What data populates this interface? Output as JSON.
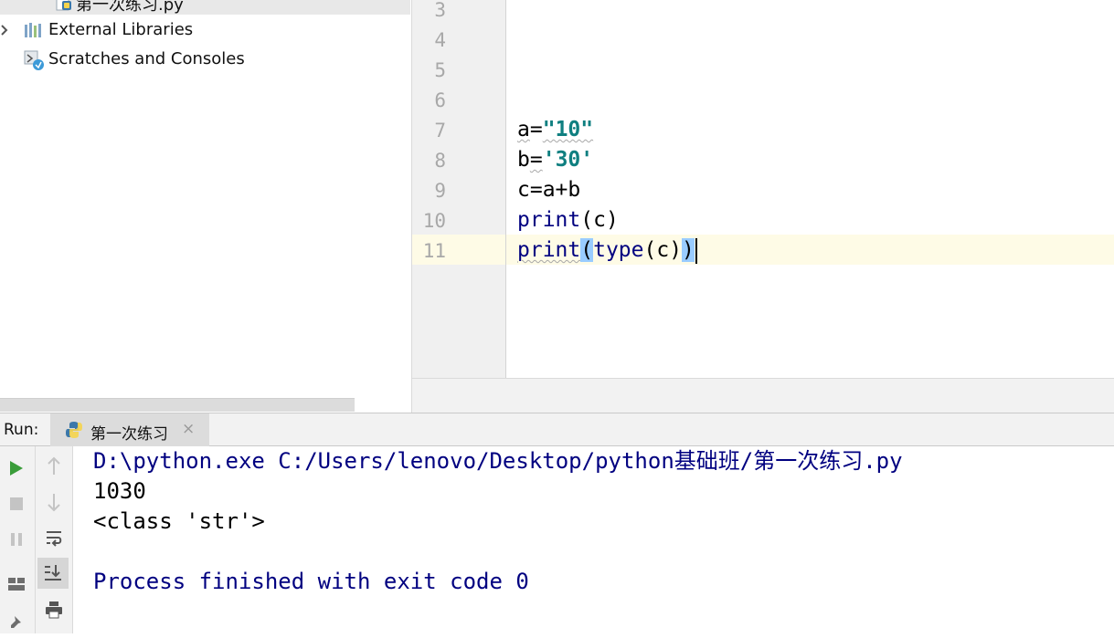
{
  "project_tree": {
    "items": [
      {
        "label": "第一次练习.py",
        "icon": "python-file-icon"
      },
      {
        "label": "External Libraries",
        "icon": "libraries-icon"
      },
      {
        "label": "Scratches and Consoles",
        "icon": "scratches-icon"
      }
    ]
  },
  "editor": {
    "line_numbers": [
      "3",
      "4",
      "5",
      "6",
      "7",
      "8",
      "9",
      "10",
      "11"
    ],
    "lines": {
      "l7": {
        "var": "a",
        "eq": "=",
        "value": "\"10\""
      },
      "l8": {
        "var": "b",
        "eq": "=",
        "value": "'30'"
      },
      "l9": {
        "text": "c=a+b"
      },
      "l10": {
        "fn": "print",
        "args": "(c)"
      },
      "l11": {
        "fn": "print",
        "open": "(",
        "inner_fn": "type",
        "inner_args": "(c)",
        "close": ")"
      }
    },
    "current_line": "11"
  },
  "run_window": {
    "label": "Run:",
    "tab_title": "第一次练习",
    "tab_close": "×",
    "console": {
      "command": "D:\\python.exe C:/Users/lenovo/Desktop/python基础班/第一次练习.py",
      "output_1": "1030",
      "output_2": "<class 'str'>",
      "exit_message": "Process finished with exit code 0"
    }
  },
  "colors": {
    "string_literal": "#0f7f80",
    "console_system": "#000080",
    "brace_highlight": "#99ccff",
    "caret_line": "#fefbe6",
    "run_green": "#3a9d3a"
  }
}
